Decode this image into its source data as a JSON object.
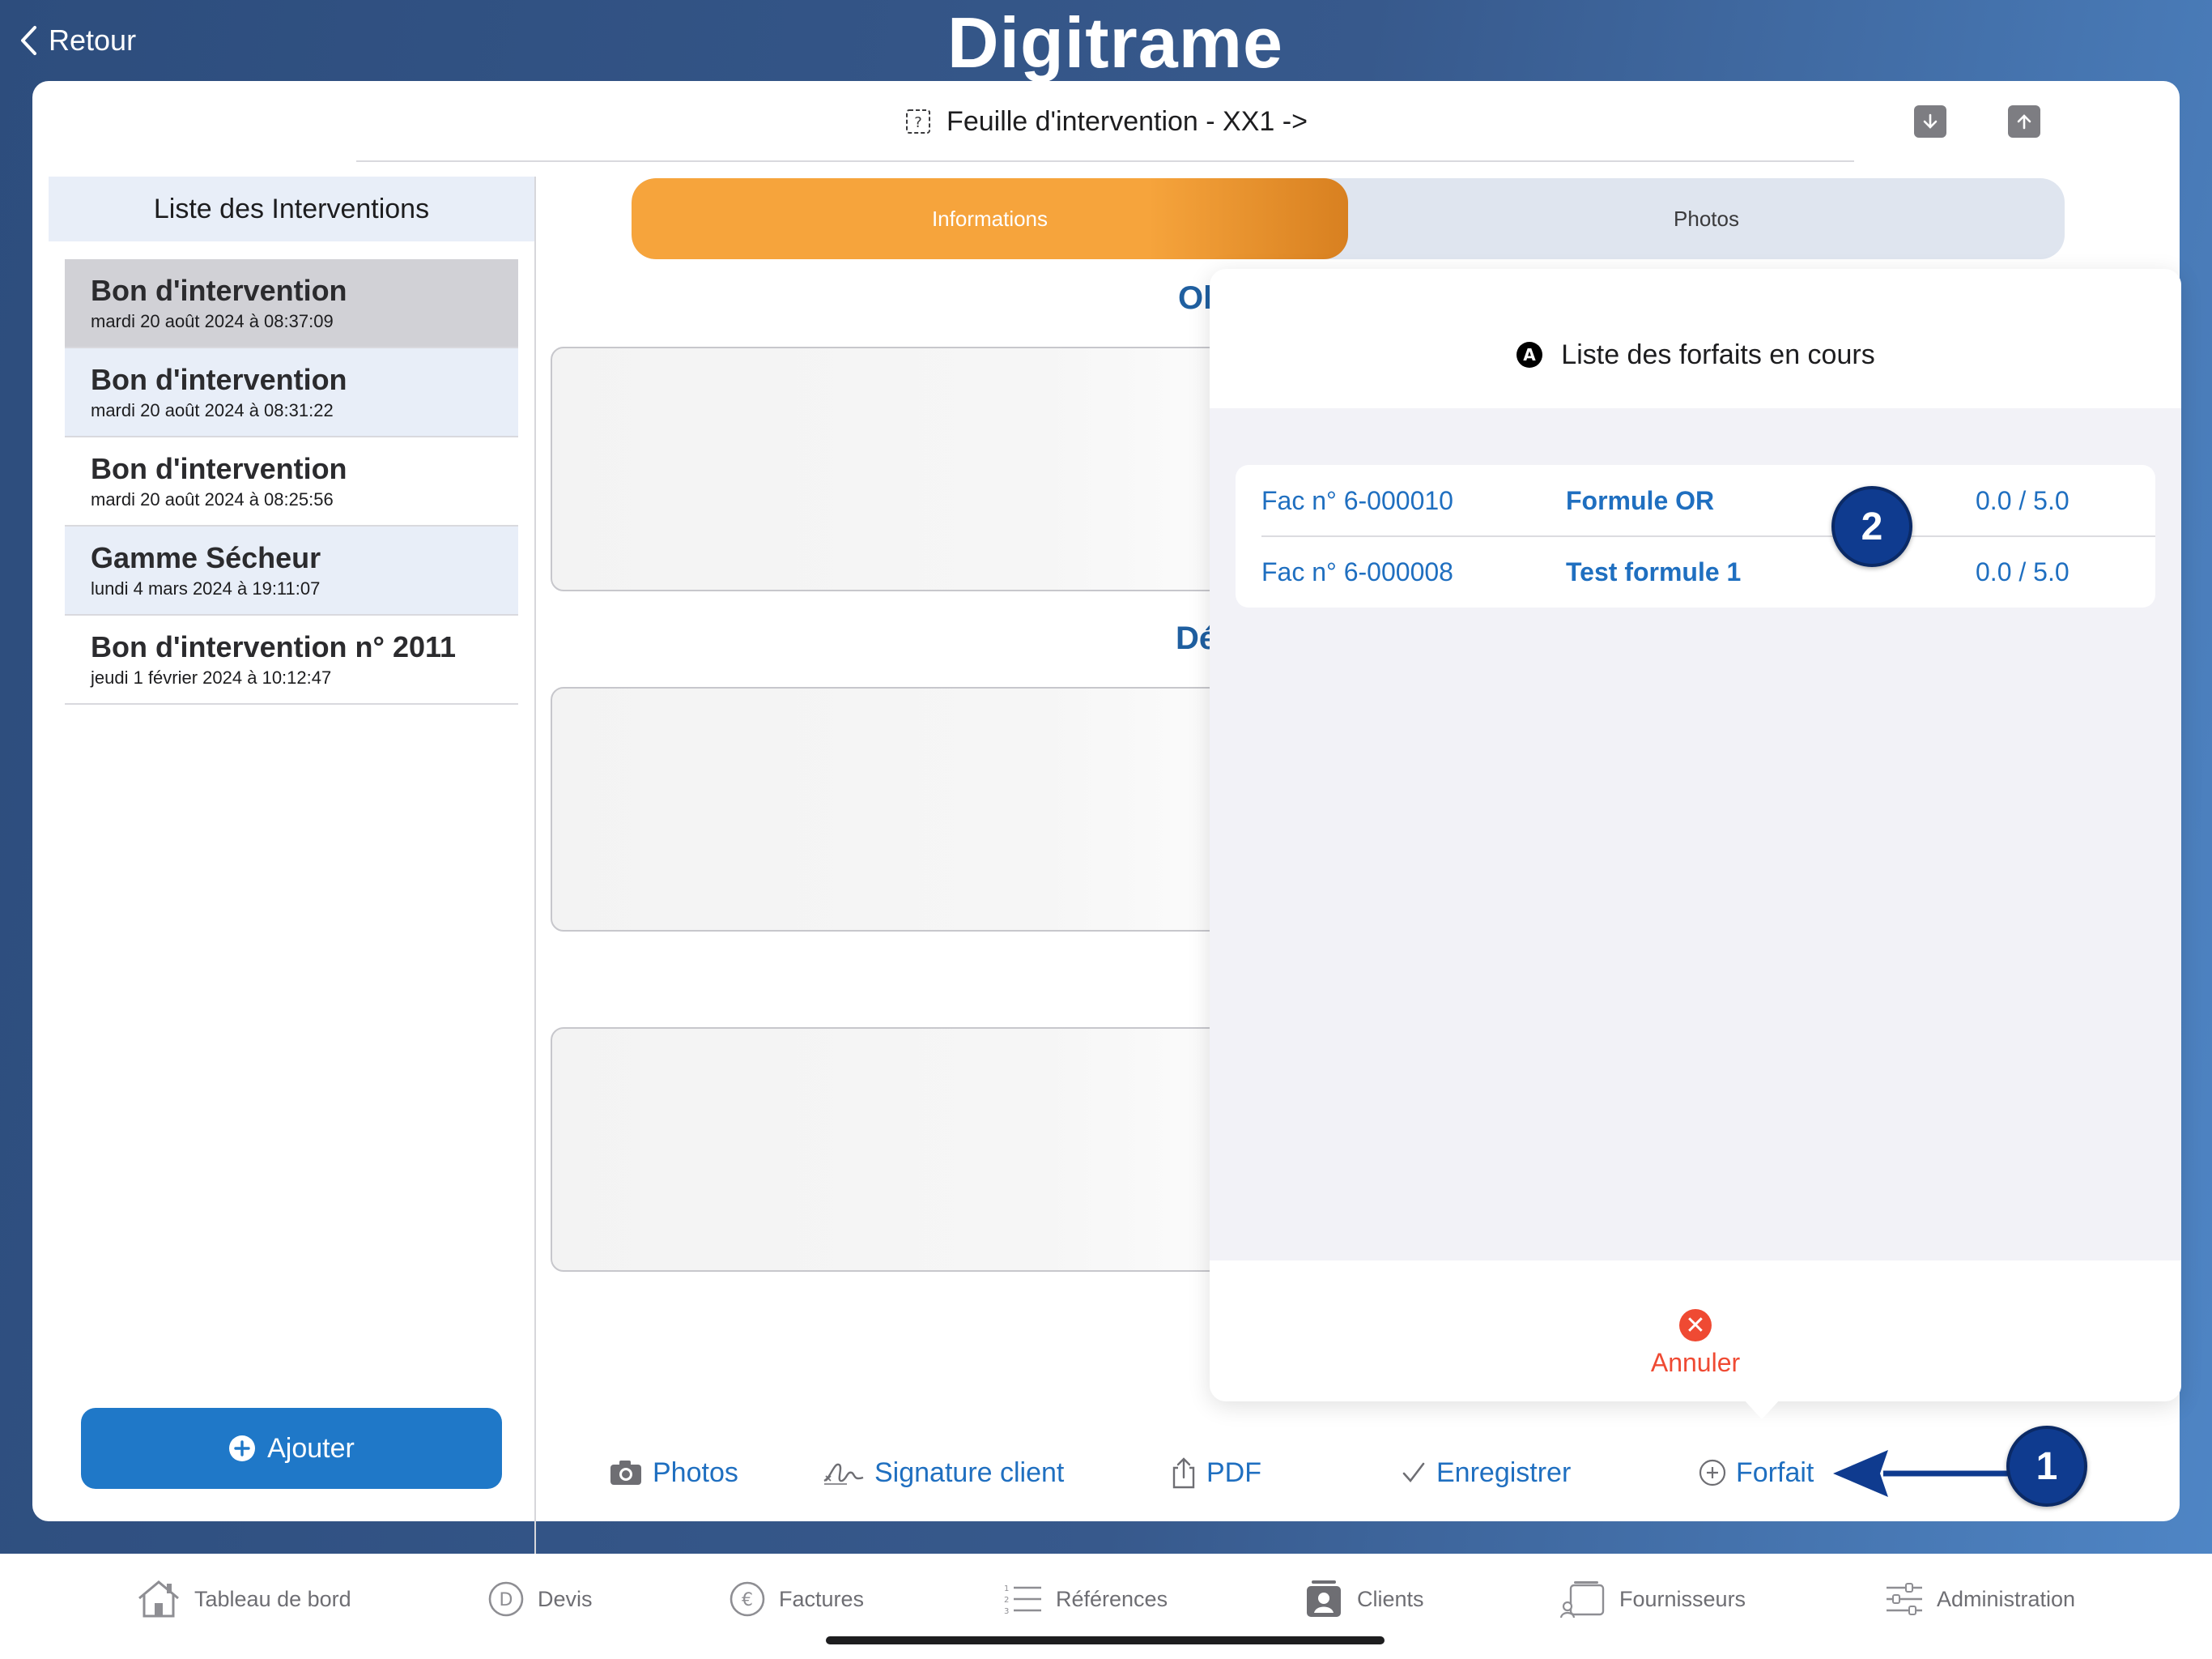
{
  "nav": {
    "back_label": "Retour",
    "app_name": "Digitrame"
  },
  "sheet": {
    "title": "Feuille d'intervention - XX1 ->"
  },
  "sidebar": {
    "header": "Liste des Interventions",
    "items": [
      {
        "title": "Bon d'intervention",
        "date": "mardi 20 août 2024 à 08:37:09"
      },
      {
        "title": "Bon d'intervention",
        "date": "mardi 20 août 2024 à 08:31:22"
      },
      {
        "title": "Bon d'intervention",
        "date": "mardi 20 août 2024 à 08:25:56"
      },
      {
        "title": "Gamme Sécheur",
        "date": "lundi 4 mars 2024 à 19:11:07"
      },
      {
        "title": "Bon d'intervention n° 2011",
        "date": "jeudi 1 février 2024 à 10:12:47"
      }
    ],
    "add_label": "Ajouter"
  },
  "tabs": {
    "informations": "Informations",
    "photos": "Photos"
  },
  "sections": {
    "s1_partial": "Ol",
    "s2_partial": "Dé"
  },
  "toolbar": {
    "photos": "Photos",
    "signature": "Signature client",
    "pdf": "PDF",
    "save": "Enregistrer",
    "forfait": "Forfait"
  },
  "popover": {
    "header_icon_letter": "A",
    "title": "Liste des forfaits en cours",
    "rows": [
      {
        "invoice": "Fac n° 6-000010",
        "name": "Formule OR",
        "usage": "0.0 / 5.0"
      },
      {
        "invoice": "Fac n° 6-000008",
        "name": "Test formule 1",
        "usage": "0.0 / 5.0"
      }
    ],
    "cancel_label": "Annuler"
  },
  "callouts": {
    "one": "1",
    "two": "2"
  },
  "tabbar": {
    "items": [
      "Tableau de bord",
      "Devis",
      "Factures",
      "Références",
      "Clients",
      "Fournisseurs",
      "Administration"
    ]
  },
  "colors": {
    "accent": "#1f6fc0",
    "tab_active": "#f6a43c",
    "danger": "#ef4a33",
    "callout": "#0f3b8f"
  }
}
